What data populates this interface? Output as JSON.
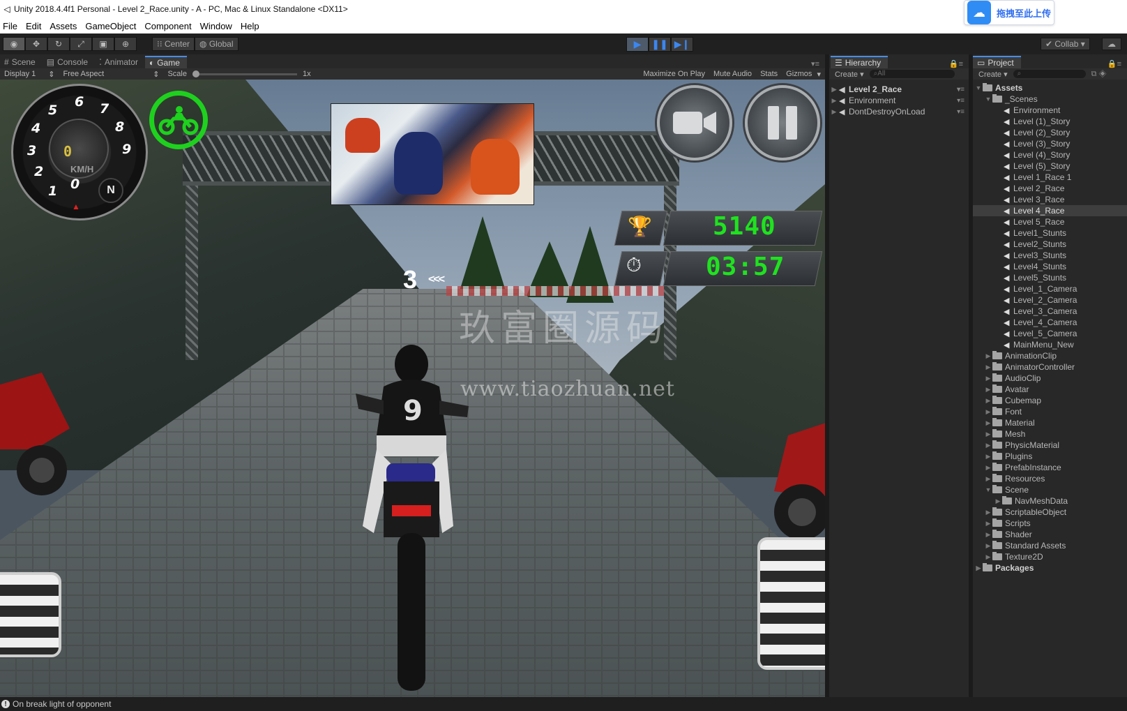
{
  "window": {
    "title": "Unity 2018.4.4f1 Personal - Level 2_Race.unity - A - PC, Mac & Linux Standalone <DX11>",
    "upload_label": "拖拽至此上传"
  },
  "menu": [
    "File",
    "Edit",
    "Assets",
    "GameObject",
    "Component",
    "Window",
    "Help"
  ],
  "toolbar": {
    "pivot_label": "Center",
    "space_label": "Global",
    "collab_label": "Collab"
  },
  "game_tabs": [
    "Scene",
    "Console",
    "Animator",
    "Game"
  ],
  "game_controls": {
    "display": "Display 1",
    "aspect": "Free Aspect",
    "scale_label": "Scale",
    "scale_value": "1x",
    "maximize": "Maximize On Play",
    "mute": "Mute Audio",
    "stats": "Stats",
    "gizmos": "Gizmos"
  },
  "game_hud": {
    "speedometer_numbers": [
      "0",
      "1",
      "2",
      "3",
      "4",
      "5",
      "6",
      "7",
      "8",
      "9"
    ],
    "speed_value": "0",
    "speed_unit": "KM/H",
    "gear": "N",
    "score": "5140",
    "timer": "03:57",
    "position": "3",
    "position_arrows": "<<<"
  },
  "watermark": {
    "cn_text": "玖富圈源码",
    "url": "www.tiaozhuan.net"
  },
  "hierarchy": {
    "tab_label": "Hierarchy",
    "create_label": "Create",
    "search_placeholder": "All",
    "items": [
      {
        "label": "Level 2_Race",
        "type": "scene"
      },
      {
        "label": "Environment",
        "type": "object"
      },
      {
        "label": "DontDestroyOnLoad",
        "type": "object"
      }
    ]
  },
  "project": {
    "tab_label": "Project",
    "create_label": "Create",
    "root": "Assets",
    "scenes_folder": "_Scenes",
    "scenes": [
      "Environment",
      "Level (1)_Story",
      "Level (2)_Story",
      "Level (3)_Story",
      "Level (4)_Story",
      "Level (5)_Story",
      "Level 1_Race 1",
      "Level 2_Race",
      "Level 3_Race",
      "Level 4_Race",
      "Level 5_Race",
      "Level1_Stunts",
      "Level2_Stunts",
      "Level3_Stunts",
      "Level4_Stunts",
      "Level5_Stunts",
      "Level_1_Camera",
      "Level_2_Camera",
      "Level_3_Camera",
      "Level_4_Camera",
      "Level_5_Camera",
      "MainMenu_New"
    ],
    "selected_scene": "Level 4_Race",
    "folders_before_scene": [
      "AnimationClip",
      "AnimatorController",
      "AudioClip",
      "Avatar",
      "Cubemap",
      "Font",
      "Material",
      "Mesh",
      "PhysicMaterial",
      "Plugins",
      "PrefabInstance",
      "Resources"
    ],
    "scene_folder": "Scene",
    "scene_subfolder": "NavMeshData",
    "folders_after_scene": [
      "ScriptableObject",
      "Scripts",
      "Shader",
      "Standard Assets",
      "Texture2D"
    ],
    "packages": "Packages"
  },
  "status": {
    "message": "On break light of opponent"
  },
  "colors": {
    "hud_green": "#1fe21f",
    "play_blue": "#3b87f0",
    "editor_dark": "#282828"
  }
}
